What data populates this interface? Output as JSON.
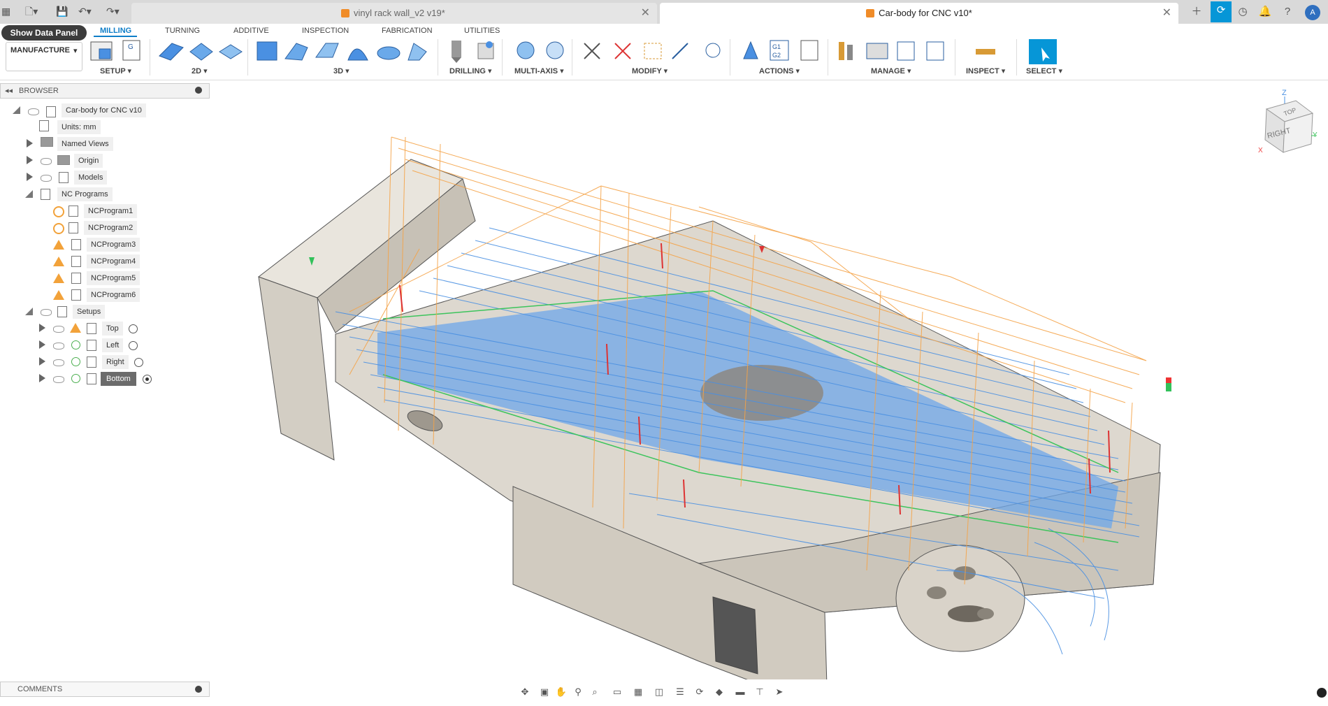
{
  "titlebar": {
    "tabs": [
      {
        "label": "vinyl rack wall_v2 v19*"
      },
      {
        "label": "Car-body for CNC v10*"
      }
    ]
  },
  "ribbon": {
    "data_panel_button": "Show Data Panel",
    "workspace": "MANUFACTURE",
    "tabs": [
      "MILLING",
      "TURNING",
      "ADDITIVE",
      "INSPECTION",
      "FABRICATION",
      "UTILITIES"
    ],
    "groups": [
      "SETUP ▾",
      "2D ▾",
      "3D ▾",
      "DRILLING ▾",
      "MULTI-AXIS ▾",
      "MODIFY ▾",
      "ACTIONS ▾",
      "MANAGE ▾",
      "INSPECT ▾",
      "SELECT ▾"
    ]
  },
  "browser": {
    "title": "BROWSER",
    "root": "Car-body for CNC v10",
    "units": "Units: mm",
    "named_views": "Named Views",
    "origin": "Origin",
    "models": "Models",
    "nc_programs": "NC Programs",
    "programs": [
      "NCProgram1",
      "NCProgram2",
      "NCProgram3",
      "NCProgram4",
      "NCProgram5",
      "NCProgram6"
    ],
    "setups": "Setups",
    "setup_items": [
      "Top",
      "Left",
      "Right",
      "Bottom"
    ]
  },
  "comments": "COMMENTS",
  "viewcube": {
    "face": "RIGHT",
    "top": "TOP",
    "axis_x": "X",
    "axis_y": "Y",
    "axis_z": "Z"
  },
  "colors": {
    "accent": "#0f7ec8",
    "toolpath_blue": "#4a90e2",
    "toolpath_orange": "#f5a347",
    "warning": "#f2a23a",
    "ok": "#4caf50"
  }
}
